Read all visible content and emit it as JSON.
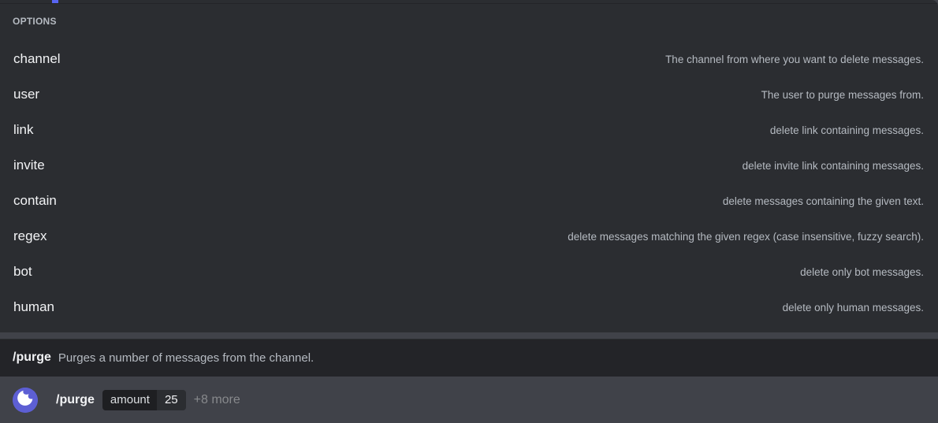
{
  "popout": {
    "section_header": "OPTIONS",
    "options": [
      {
        "name": "channel",
        "description": "The channel from where you want to delete messages."
      },
      {
        "name": "user",
        "description": "The user to purge messages from."
      },
      {
        "name": "link",
        "description": "delete link containing messages."
      },
      {
        "name": "invite",
        "description": "delete invite link containing messages."
      },
      {
        "name": "contain",
        "description": "delete messages containing the given text."
      },
      {
        "name": "regex",
        "description": "delete messages matching the given regex (case insensitive, fuzzy search)."
      },
      {
        "name": "bot",
        "description": "delete only bot messages."
      },
      {
        "name": "human",
        "description": "delete only human messages."
      }
    ]
  },
  "command_footer": {
    "command_name": "/purge",
    "command_description": "Purges a number of messages from the channel."
  },
  "input_bar": {
    "avatar_icon": "crescent-moon-bot-avatar",
    "command_name": "/purge",
    "argument": {
      "key": "amount",
      "value": "25"
    },
    "more_label": "+8 more"
  },
  "colors": {
    "popout_background": "#2b2d31",
    "footer_background": "#232428",
    "input_background": "#404249",
    "option_name_text": "#f2f3f5",
    "option_description_text": "#b5bac1",
    "accent_purple": "#5865f2",
    "avatar_purple": "#5d5fd4",
    "pill_key_background": "#1e1f22",
    "pill_value_background": "#2b2d31",
    "more_label_text": "#87898c"
  }
}
